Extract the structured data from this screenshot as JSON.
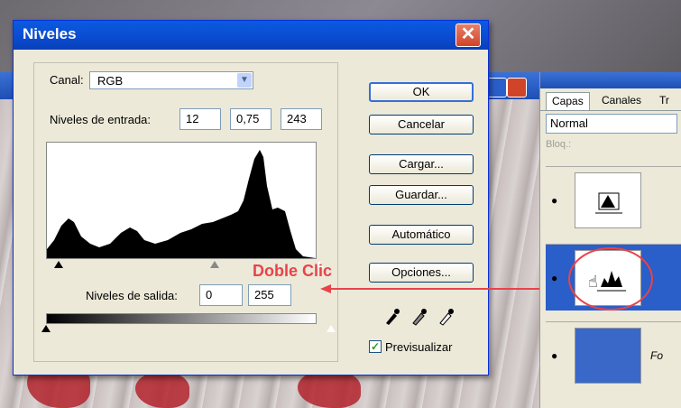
{
  "dialog": {
    "title": "Niveles",
    "close_label": "✕",
    "channel_label": "Canal:",
    "channel_value": "RGB",
    "input_levels_label": "Niveles de entrada:",
    "input_levels": [
      "12",
      "0,75",
      "243"
    ],
    "output_levels_label": "Niveles de salida:",
    "output_levels": [
      "0",
      "255"
    ],
    "buttons": {
      "ok": "OK",
      "cancel": "Cancelar",
      "load": "Cargar...",
      "save": "Guardar...",
      "auto": "Automático",
      "options": "Opciones..."
    },
    "preview_label": "Previsualizar",
    "preview_checked": true
  },
  "annotation": {
    "text": "Doble Clic",
    "color": "#e8434a"
  },
  "layers_panel": {
    "tabs": [
      "Capas",
      "Canales",
      "Tr"
    ],
    "blend_mode": "Normal",
    "lock_label": "Bloq.:",
    "layer_name_partial": "Fo"
  },
  "icons": {
    "close": "close-icon",
    "eye": "eye-icon",
    "eyedropper": "eyedropper-icon",
    "hand": "hand-cursor-icon",
    "chevron": "chevron-down-icon"
  },
  "colors": {
    "titlebar": "#0a5be0",
    "dialog_bg": "#ece9d8",
    "close_red": "#d0442a",
    "annotation_red": "#e8434a",
    "check_green": "#21a121"
  }
}
